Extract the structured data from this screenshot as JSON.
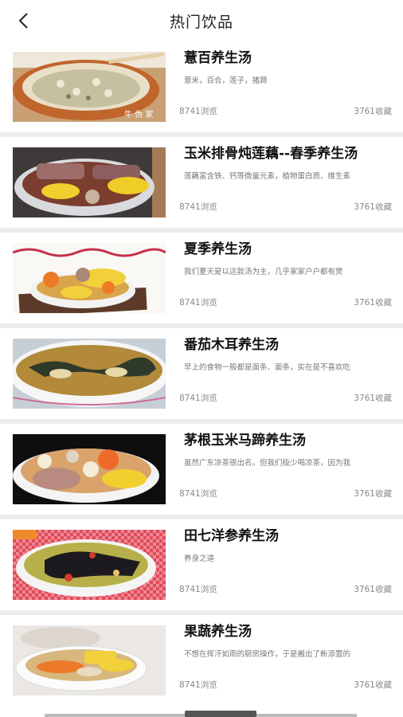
{
  "header": {
    "title": "热门饮品",
    "back_icon": "chevron-left-icon"
  },
  "items": [
    {
      "name": "薏百养生汤",
      "desc": "薏米，百合，莲子，猪蹄",
      "views": "8741浏览",
      "favs": "3761收藏",
      "image": "congee-bowl"
    },
    {
      "name": "玉米排骨炖莲藕--春季养生汤",
      "desc": "莲藕富含铁、钙等微量元素，植物蛋白质、维生素",
      "views": "8741浏览",
      "favs": "3761收藏",
      "image": "corn-rib-soup"
    },
    {
      "name": "夏季养生汤",
      "desc": "我们夏天是以这款汤为主，几乎家家户户都有煲",
      "views": "8741浏览",
      "favs": "3761收藏",
      "image": "corn-carrot-soup"
    },
    {
      "name": "番茄木耳养生汤",
      "desc": "早上的食物一般都是面条、面条，实在是不喜欢吃",
      "views": "8741浏览",
      "favs": "3761收藏",
      "image": "fungus-soup"
    },
    {
      "name": "茅根玉米马蹄养生汤",
      "desc": "虽然广东凉茶很出名。但我们极少喝凉茶，因为我",
      "views": "8741浏览",
      "favs": "3761收藏",
      "image": "chestnut-corn-soup"
    },
    {
      "name": "田七洋参养生汤",
      "desc": "养身之道",
      "views": "8741浏览",
      "favs": "3761收藏",
      "image": "herbal-chicken-soup"
    },
    {
      "name": "果蔬养生汤",
      "desc": "不想在挥汗如雨的厨房操作，于是搬出了新添置的",
      "views": "8741浏览",
      "favs": "3761收藏",
      "image": "veg-soup"
    }
  ]
}
